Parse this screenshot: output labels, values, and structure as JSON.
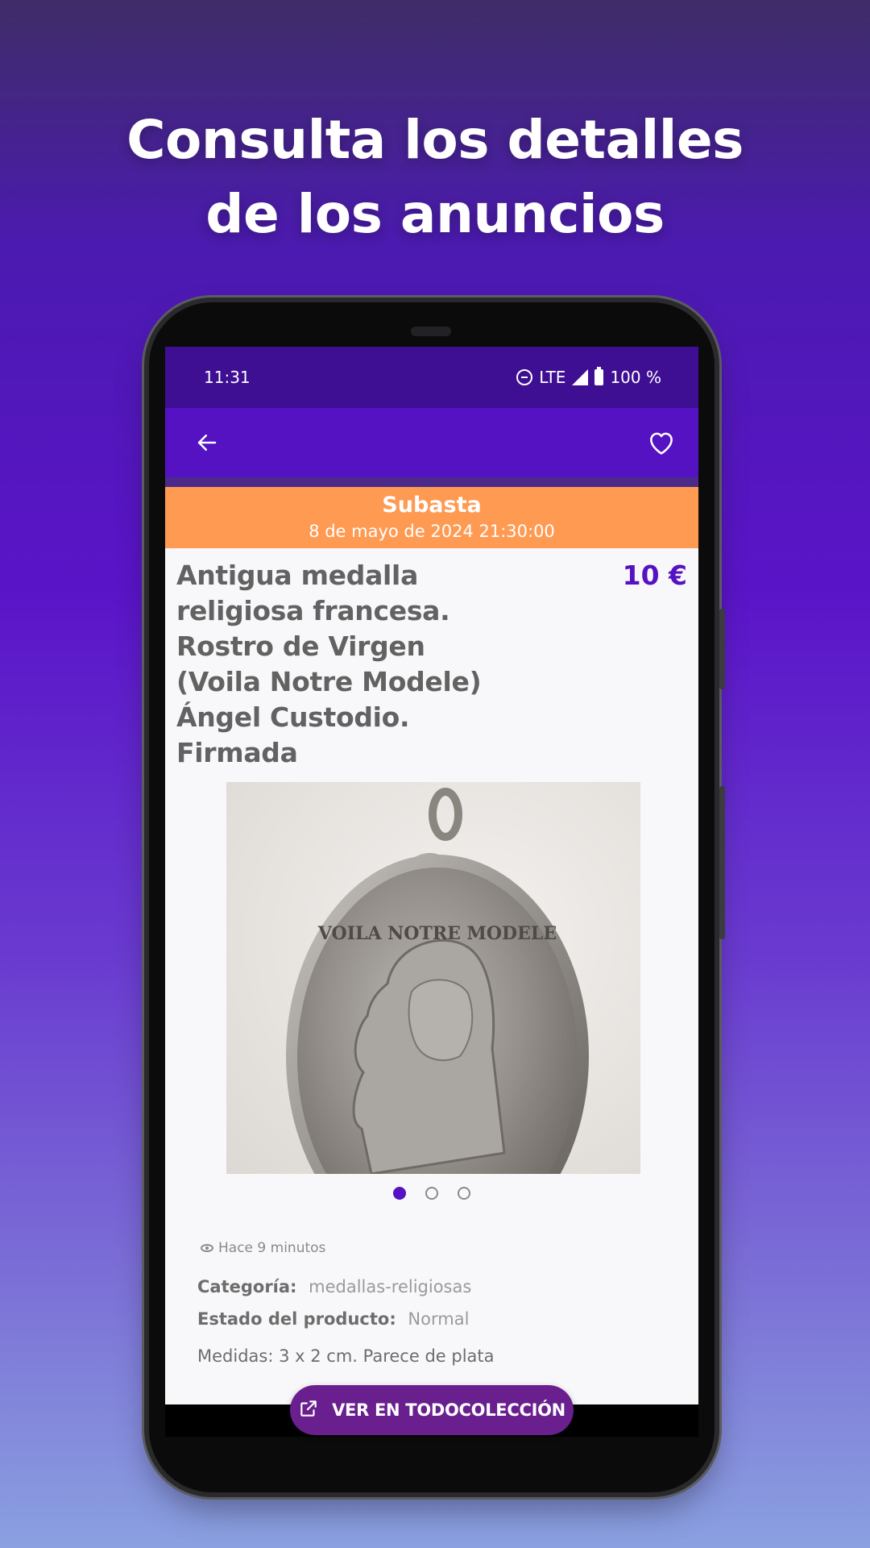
{
  "headline": {
    "line1": "Consulta los detalles",
    "line2": "de los anuncios"
  },
  "status_bar": {
    "time": "11:31",
    "network": "LTE",
    "battery": "100 %"
  },
  "app_bar": {
    "back_icon": "arrow-left-icon",
    "favorite_icon": "heart-outline-icon"
  },
  "auction": {
    "label": "Subasta",
    "date": "8 de mayo de 2024 21:30:00"
  },
  "item": {
    "title_lines": [
      "Antigua medalla",
      "religiosa francesa.",
      "Rostro de Virgen",
      "(Voila Notre Modele)",
      "Ángel Custodio.",
      "Firmada"
    ],
    "price": "10 €",
    "photo_inscription": "VOILA NOTRE MODELE",
    "carousel": {
      "count": 3,
      "active_index": 0
    },
    "time_ago": "Hace 9 minutos",
    "category_label": "Categoría:",
    "category_value": "medallas-religiosas",
    "condition_label": "Estado del producto:",
    "condition_value": "Normal",
    "description": "Medidas: 3 x 2 cm. Parece de plata"
  },
  "cta": {
    "label": "VER EN TODOCOLECCIÓN",
    "icon": "external-link-icon"
  },
  "colors": {
    "primary": "#5412c2",
    "status_bar": "#3e0f93",
    "auction_banner": "#ff9a52",
    "cta": "#6a1f8f"
  }
}
